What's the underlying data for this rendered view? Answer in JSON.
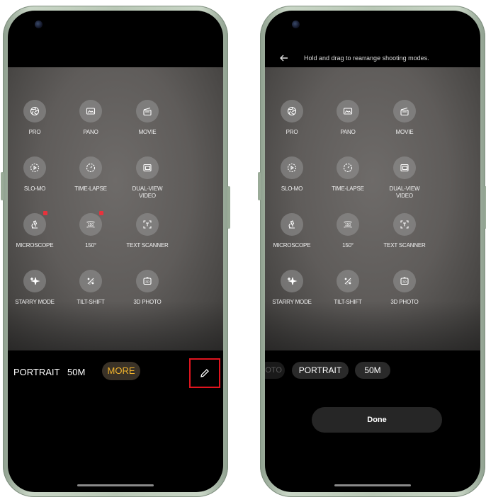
{
  "left_phone": {
    "modes": [
      {
        "label": "PRO",
        "icon": "aperture-icon",
        "badge": false
      },
      {
        "label": "PANO",
        "icon": "panorama-icon",
        "badge": false
      },
      {
        "label": "MOVIE",
        "icon": "clapperboard-icon",
        "badge": false
      },
      {
        "label": "SLO-MO",
        "icon": "slow-motion-icon",
        "badge": false
      },
      {
        "label": "TIME-LAPSE",
        "icon": "timer-icon",
        "badge": false
      },
      {
        "label": "DUAL-VIEW\nVIDEO",
        "icon": "dual-view-icon",
        "badge": false
      },
      {
        "label": "MICROSCOPE",
        "icon": "microscope-icon",
        "badge": true
      },
      {
        "label": "150°",
        "icon": "wide-angle-icon",
        "badge": true
      },
      {
        "label": "TEXT SCANNER",
        "icon": "text-scan-icon",
        "badge": false
      },
      {
        "label": "STARRY MODE",
        "icon": "sparkle-icon",
        "badge": false
      },
      {
        "label": "TILT-SHIFT",
        "icon": "tilt-shift-icon",
        "badge": false
      },
      {
        "label": "3D PHOTO",
        "icon": "3d-photo-icon",
        "badge": false
      }
    ],
    "bottom_modes": {
      "portrait": "PORTRAIT",
      "fifty_m": "50M",
      "more": "MORE"
    },
    "edit_icon": "pencil-icon",
    "highlight_color": "#e0141e",
    "more_color": "#f3b52c"
  },
  "right_phone": {
    "header": {
      "hint": "Hold and drag to rearrange shooting modes.",
      "back_icon": "back-arrow-icon"
    },
    "modes": [
      {
        "label": "PRO",
        "icon": "aperture-icon"
      },
      {
        "label": "PANO",
        "icon": "panorama-icon"
      },
      {
        "label": "MOVIE",
        "icon": "clapperboard-icon"
      },
      {
        "label": "SLO-MO",
        "icon": "slow-motion-icon"
      },
      {
        "label": "TIME-LAPSE",
        "icon": "timer-icon"
      },
      {
        "label": "DUAL-VIEW\nVIDEO",
        "icon": "dual-view-icon"
      },
      {
        "label": "MICROSCOPE",
        "icon": "microscope-icon"
      },
      {
        "label": "150°",
        "icon": "wide-angle-icon"
      },
      {
        "label": "TEXT SCANNER",
        "icon": "text-scan-icon"
      },
      {
        "label": "STARRY MODE",
        "icon": "sparkle-icon"
      },
      {
        "label": "TILT-SHIFT",
        "icon": "tilt-shift-icon"
      },
      {
        "label": "3D PHOTO",
        "icon": "3d-photo-icon"
      }
    ],
    "bottom_modes": {
      "ghost": "OTO",
      "portrait": "PORTRAIT",
      "fifty_m": "50M"
    },
    "done_label": "Done"
  }
}
